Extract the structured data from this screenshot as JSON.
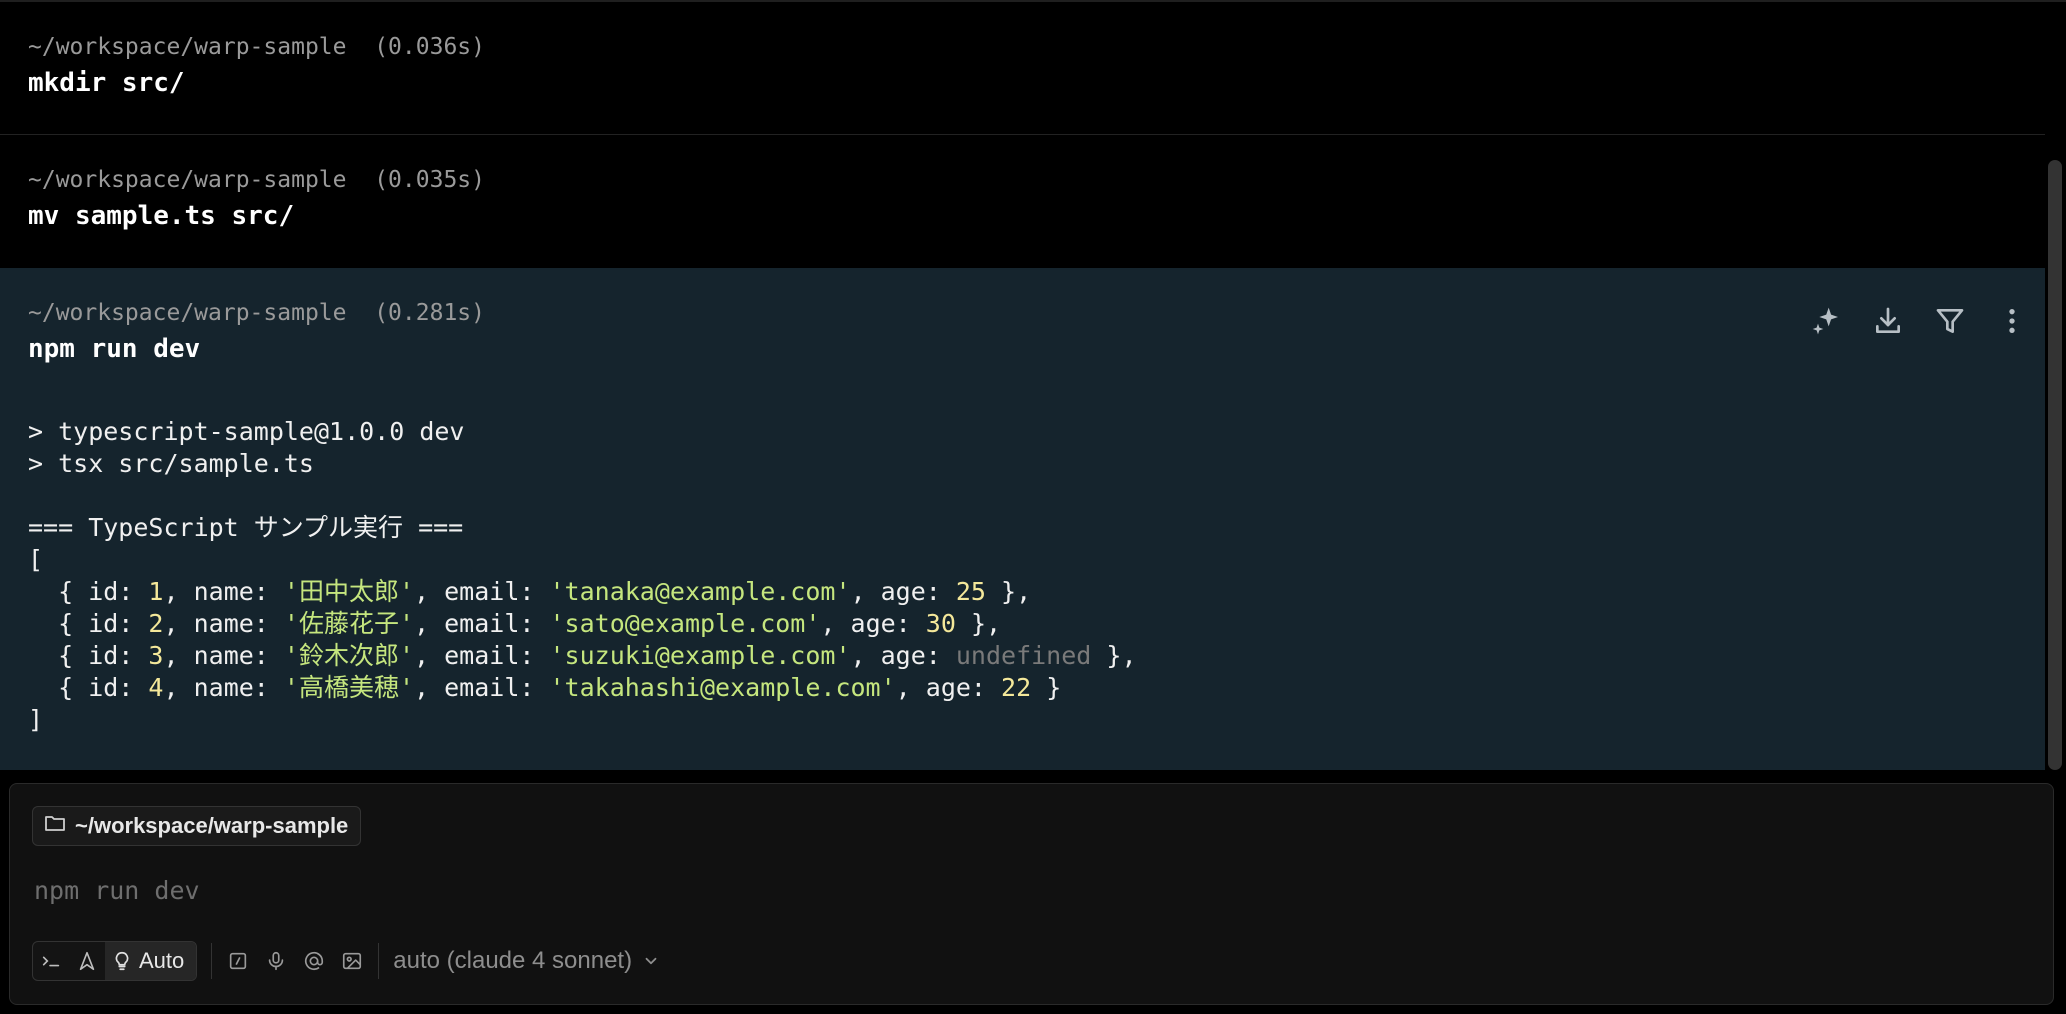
{
  "blocks": [
    {
      "path": "~/workspace/warp-sample",
      "time": "(0.036s)",
      "command": "mkdir src/"
    },
    {
      "path": "~/workspace/warp-sample",
      "time": "(0.035s)",
      "command": "mv sample.ts src/"
    },
    {
      "path": "~/workspace/warp-sample",
      "time": "(0.281s)",
      "command": "npm run dev",
      "output": {
        "script_line1": "> typescript-sample@1.0.0 dev",
        "script_line2": "> tsx src/sample.ts",
        "heading": "=== TypeScript サンプル実行 ===",
        "open": "[",
        "close": "]",
        "records": [
          {
            "id": "1",
            "name": "'田中太郎'",
            "email": "'tanaka@example.com'",
            "age": "25",
            "age_undefined": false
          },
          {
            "id": "2",
            "name": "'佐藤花子'",
            "email": "'sato@example.com'",
            "age": "30",
            "age_undefined": false
          },
          {
            "id": "3",
            "name": "'鈴木次郎'",
            "email": "'suzuki@example.com'",
            "age": "undefined",
            "age_undefined": true
          },
          {
            "id": "4",
            "name": "'高橋美穂'",
            "email": "'takahashi@example.com'",
            "age": "22",
            "age_undefined": false
          }
        ]
      }
    }
  ],
  "block_tools": [
    "ai-sparkle-icon",
    "download-icon",
    "filter-icon",
    "more-vertical-icon"
  ],
  "input": {
    "cwd": "~/workspace/warp-sample",
    "placeholder": "npm run dev",
    "mode_label": "Auto",
    "model_label": "auto (claude 4 sonnet)"
  },
  "colors": {
    "background": "#000000",
    "active_block": "#15242d",
    "string": "#c5e67e",
    "number": "#f4e89a",
    "muted": "#9a9a9a"
  }
}
